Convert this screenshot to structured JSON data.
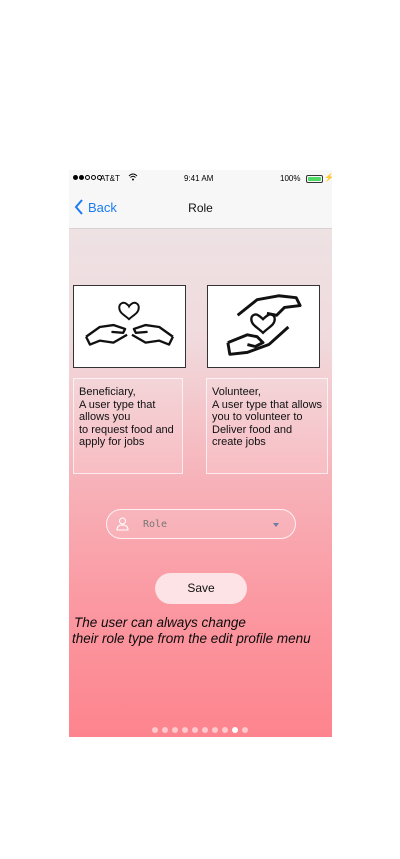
{
  "status_bar": {
    "carrier": "AT&T",
    "time": "9:41 AM",
    "battery": "100%"
  },
  "nav": {
    "back_label": "Back",
    "title": "Role"
  },
  "roles": [
    {
      "icon": "hands-heart-icon",
      "lines": [
        "Beneficiary,",
        "A user type that",
        "allows you",
        "to request food and",
        "apply for jobs"
      ]
    },
    {
      "icon": "hands-giving-heart-icon",
      "lines": [
        "Volunteer,",
        "A user type that allows",
        "you to volunteer to",
        "Deliver food and",
        "create jobs"
      ]
    }
  ],
  "role_select": {
    "placeholder": "Role",
    "icon": "person-icon"
  },
  "save_label": "Save",
  "note": {
    "line1": "The user can always change",
    "line2": " their role type from the edit profile menu"
  },
  "pager": {
    "count": 10,
    "active_index": 8
  },
  "colors": {
    "accent": "#1a7cf2",
    "gradient_top": "#ede6e7",
    "gradient_bottom": "#fd848e",
    "save_button": "#fde3e5"
  }
}
